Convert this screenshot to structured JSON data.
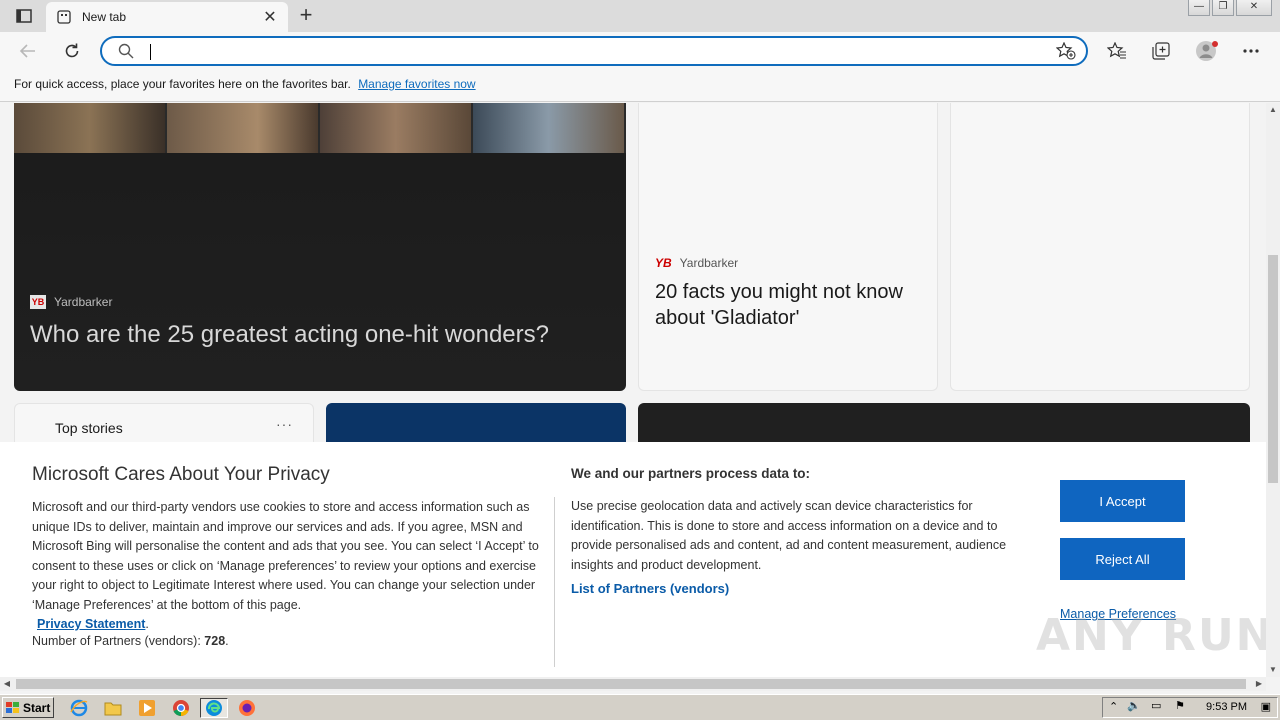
{
  "browser": {
    "tab_title": "New tab",
    "address_value": "",
    "address_placeholder": ""
  },
  "favorites_bar": {
    "message": "For quick access, place your favorites here on the favorites bar.",
    "link": "Manage favorites now"
  },
  "feed": {
    "hero": {
      "source": "Yardbarker",
      "title": "Who are the 25 greatest acting one-hit wonders?"
    },
    "card2": {
      "source": "Yardbarker",
      "title": "20 facts you might not know about 'Gladiator'"
    },
    "top_stories": {
      "title": "Top stories",
      "more": "···"
    }
  },
  "privacy": {
    "title": "Microsoft Cares About Your Privacy",
    "body": "Microsoft and our third-party vendors use cookies to store and access information such as unique IDs to deliver, maintain and improve our services and ads. If you agree, MSN and Microsoft Bing will personalise the content and ads that you see. You can select ‘I Accept’ to consent to these uses or click on ‘Manage preferences’ to review your options and exercise your right to object to Legitimate Interest where used.  You can change your selection under ‘Manage Preferences’ at the bottom of this page.",
    "privacy_statement": "Privacy Statement",
    "partners_label": "Number of Partners (vendors):",
    "partners_count": "728",
    "subtitle": "We and our partners process data to:",
    "description": "Use precise geolocation data and actively scan device characteristics for identification. This is done to store and access information on a device and to provide personalised ads and content, ad and content measurement, audience insights and product development.",
    "list_link": "List of Partners (vendors)",
    "accept": "I Accept",
    "reject": "Reject All",
    "manage": "Manage Preferences"
  },
  "watermark": "ANY RUN",
  "taskbar": {
    "start": "Start",
    "time": "9:53 PM"
  },
  "colors": {
    "accent": "#0f6cbd",
    "button": "#0f65c0",
    "link": "#0a5ba8"
  }
}
